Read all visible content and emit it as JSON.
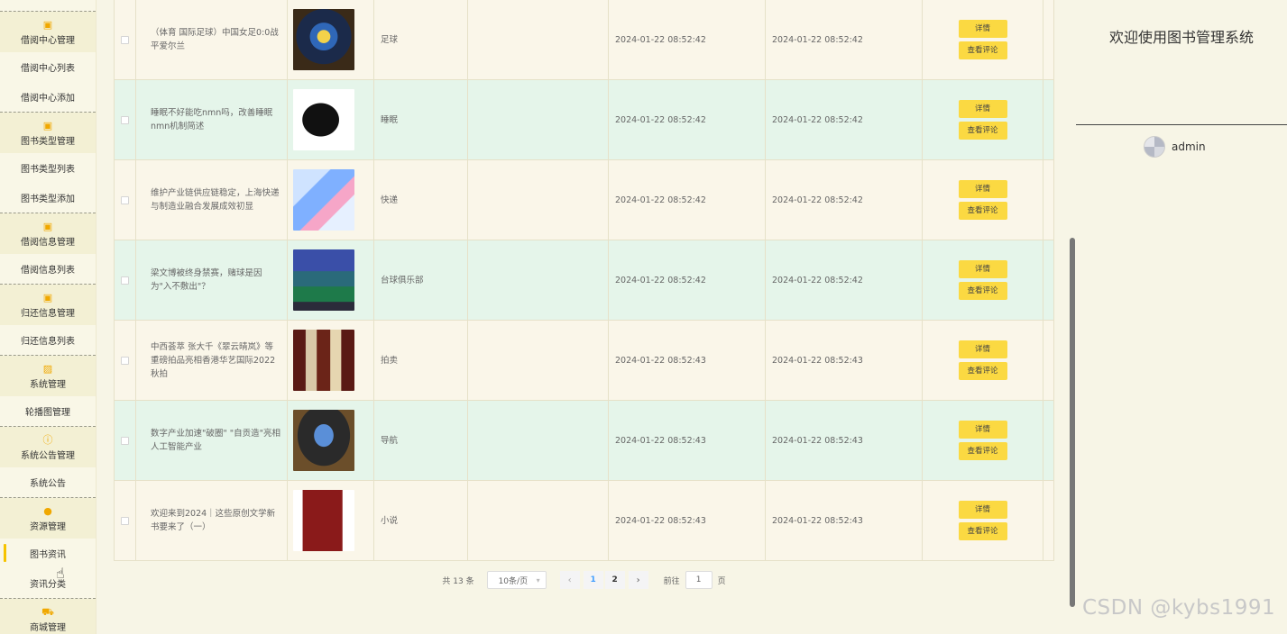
{
  "sidebar": {
    "groups": [
      {
        "title": "借阅中心管理",
        "icon": "folder-icon",
        "items": [
          "借阅中心列表",
          "借阅中心添加"
        ]
      },
      {
        "title": "图书类型管理",
        "icon": "folder-icon",
        "items": [
          "图书类型列表",
          "图书类型添加"
        ]
      },
      {
        "title": "借阅信息管理",
        "icon": "folder-icon",
        "items": [
          "借阅信息列表"
        ]
      },
      {
        "title": "归还信息管理",
        "icon": "folder-icon",
        "items": [
          "归还信息列表"
        ]
      },
      {
        "title": "系统管理",
        "icon": "picture-icon",
        "items": [
          "轮播图管理"
        ]
      },
      {
        "title": "系统公告管理",
        "icon": "info-icon",
        "items": [
          "系统公告"
        ]
      },
      {
        "title": "资源管理",
        "icon": "bulb-icon",
        "items": [
          "图书资讯",
          "资讯分类"
        ]
      },
      {
        "title": "商城管理",
        "icon": "cart-icon",
        "items": []
      }
    ],
    "active_item": "图书资讯"
  },
  "table": {
    "rows": [
      {
        "title": "（体育 国际足球）中国女足0:0战平爱尔兰",
        "category": "足球",
        "created": "2024-01-22 08:52:42",
        "updated": "2024-01-22 08:52:42",
        "thumb": "football-badge-image"
      },
      {
        "title": "睡眠不好能吃nmn吗，改善睡眠nmn机制简述",
        "category": "睡眠",
        "created": "2024-01-22 08:52:42",
        "updated": "2024-01-22 08:52:42",
        "thumb": "head-silhouette-image"
      },
      {
        "title": "维护产业链供应链稳定，上海快递与制造业融合发展成效初显",
        "category": "快递",
        "created": "2024-01-22 08:52:42",
        "updated": "2024-01-22 08:52:42",
        "thumb": "isometric-delivery-image"
      },
      {
        "title": "梁文博被终身禁赛，赌球是因为\"入不敷出\"？",
        "category": "台球俱乐部",
        "created": "2024-01-22 08:52:42",
        "updated": "2024-01-22 08:52:42",
        "thumb": "billiard-hall-image"
      },
      {
        "title": "中西荟萃 张大千《翠云晴岚》等重磅拍品亮相香港华艺国际2022秋拍",
        "category": "拍卖",
        "created": "2024-01-22 08:52:43",
        "updated": "2024-01-22 08:52:43",
        "thumb": "art-gallery-image"
      },
      {
        "title": "数字产业加速\"破圈\" \"自贡造\"亮相人工智能产业",
        "category": "导航",
        "created": "2024-01-22 08:52:43",
        "updated": "2024-01-22 08:52:43",
        "thumb": "exhibition-screen-image"
      },
      {
        "title": "欢迎来到2024｜这些原创文学新书要来了（一）",
        "category": "小说",
        "created": "2024-01-22 08:52:43",
        "updated": "2024-01-22 08:52:43",
        "thumb": "red-book-image"
      }
    ],
    "detail_label": "详情",
    "comments_label": "查看评论"
  },
  "pagination": {
    "total": "共 13 条",
    "page_size": "10条/页",
    "pages": [
      "1",
      "2"
    ],
    "current_page": "1",
    "goto_label": "前往",
    "goto_value": "1",
    "page_unit": "页",
    "prev_icon": "‹",
    "next_icon": "›"
  },
  "right_panel": {
    "welcome": "欢迎使用图书管理系统",
    "username": "admin"
  },
  "watermark": "CSDN @kybs1991",
  "colors": {
    "accent_button": "#fbd942",
    "row_odd": "#faf6e9",
    "row_even": "#e5f5ea",
    "sidebar_bg": "#f9f7e7",
    "active_marker": "#f6c300"
  }
}
